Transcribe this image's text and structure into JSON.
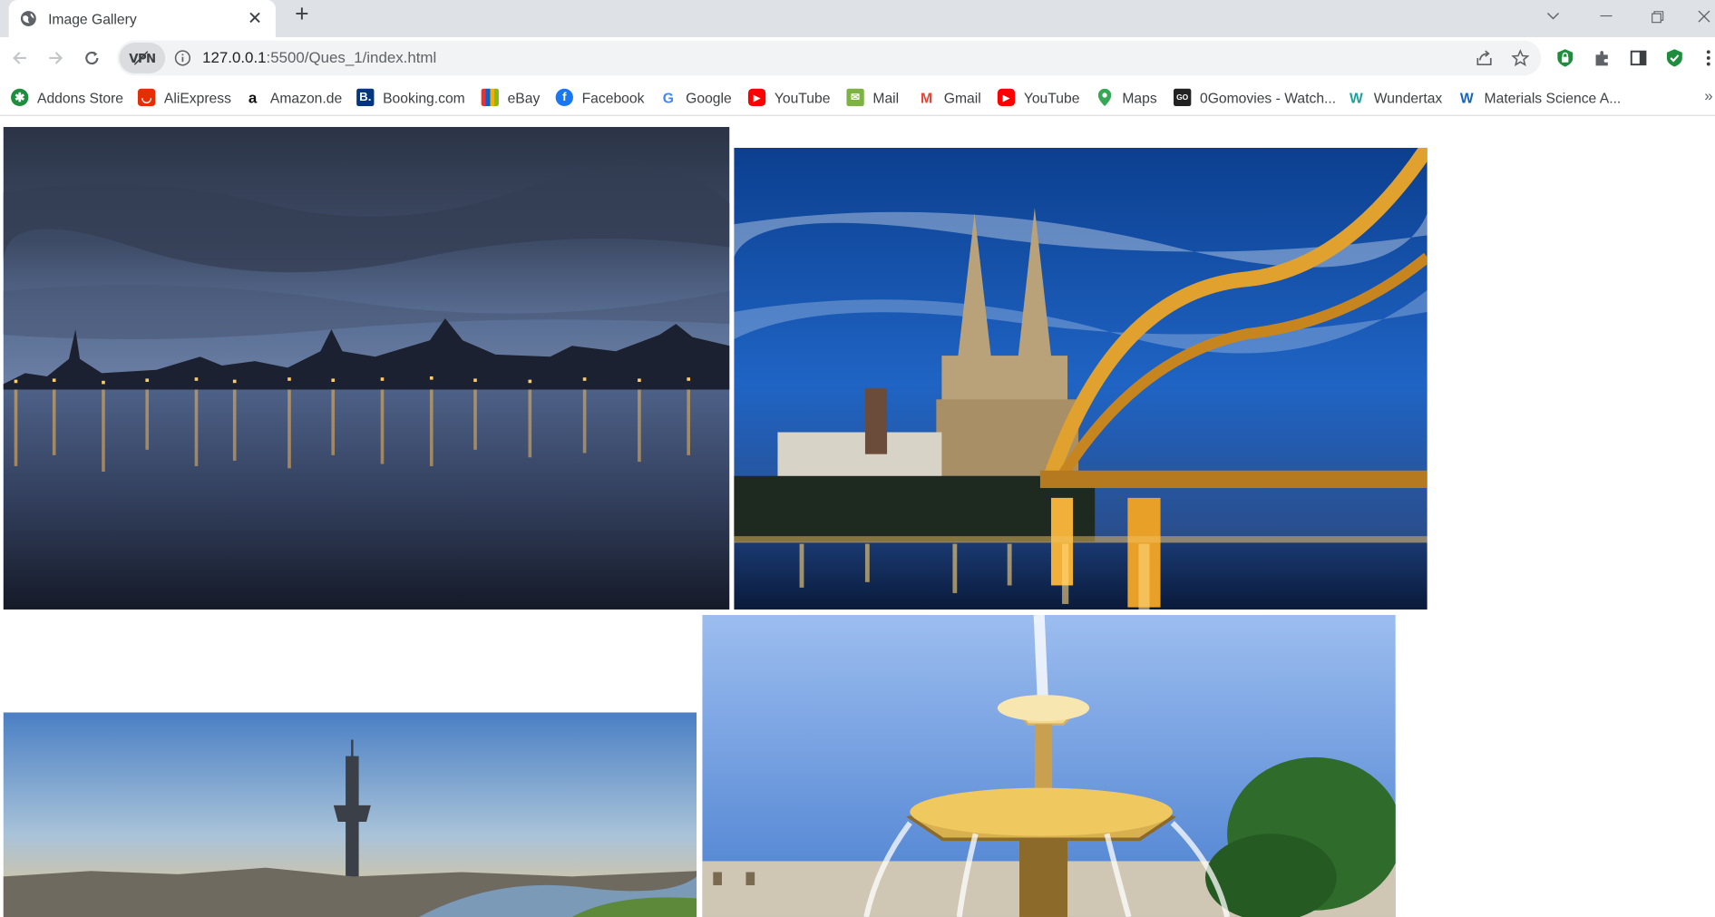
{
  "tab": {
    "title": "Image Gallery",
    "icon": "globe-icon"
  },
  "address": {
    "host": "127.0.0.1",
    "path": ":5500/Ques_1/index.html",
    "vpn_label": "VPN"
  },
  "bookmarks": [
    {
      "label": "Addons Store",
      "icon": "addons-store-icon",
      "color": "#1e8e3e"
    },
    {
      "label": "AliExpress",
      "icon": "aliexpress-icon",
      "color": "#e62e04"
    },
    {
      "label": "Amazon.de",
      "icon": "amazon-icon",
      "color": "#111111"
    },
    {
      "label": "Booking.com",
      "icon": "booking-icon",
      "color": "#003580"
    },
    {
      "label": "eBay",
      "icon": "ebay-icon",
      "color": "#e53238"
    },
    {
      "label": "Facebook",
      "icon": "facebook-icon",
      "color": "#1877f2"
    },
    {
      "label": "Google",
      "icon": "google-icon",
      "color": "#4285f4"
    },
    {
      "label": "YouTube",
      "icon": "youtube-icon",
      "color": "#ff0000"
    },
    {
      "label": "Mail",
      "icon": "mail-icon",
      "color": "#7cb342"
    },
    {
      "label": "Gmail",
      "icon": "gmail-icon",
      "color": "#ea4335"
    },
    {
      "label": "YouTube",
      "icon": "youtube-icon",
      "color": "#ff0000"
    },
    {
      "label": "Maps",
      "icon": "maps-icon",
      "color": "#34a853"
    },
    {
      "label": "0Gomovies - Watch...",
      "icon": "gomovies-icon",
      "color": "#222222"
    },
    {
      "label": "Wundertax",
      "icon": "wundertax-icon",
      "color": "#1aa39a"
    },
    {
      "label": "Materials Science A...",
      "icon": "materials-science-icon",
      "color": "#f4b400"
    }
  ],
  "gallery": {
    "images": [
      {
        "name": "rostock-harbour-night-image"
      },
      {
        "name": "cologne-cathedral-bridge-image"
      },
      {
        "name": "dusseldorf-rhine-tower-image"
      },
      {
        "name": "stuttgart-fountain-image"
      }
    ]
  }
}
